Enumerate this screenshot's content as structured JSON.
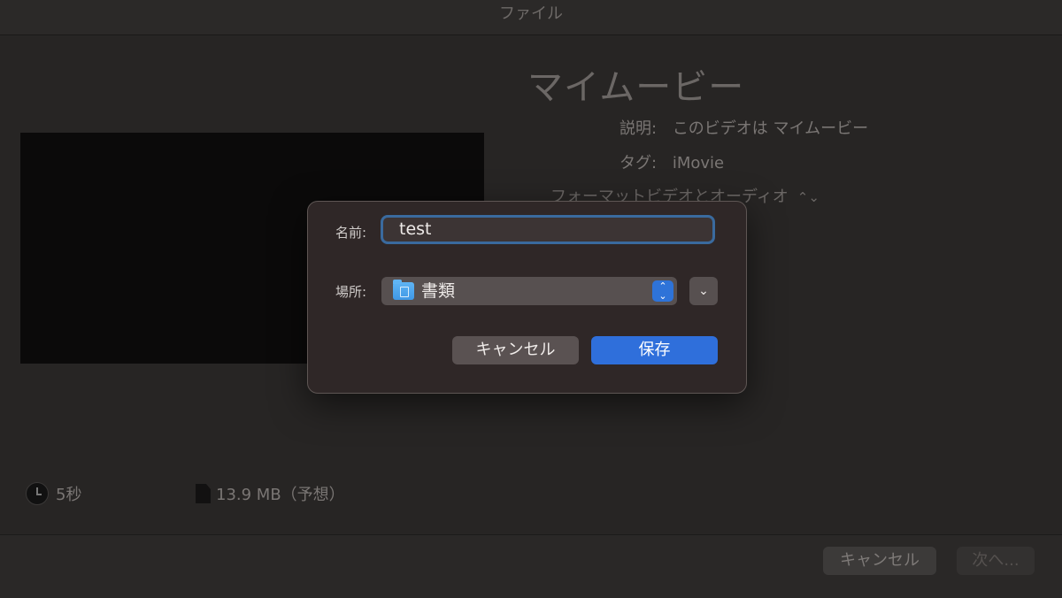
{
  "window": {
    "title": "ファイル"
  },
  "movie": {
    "title": "マイムービー",
    "description_label": "説明:",
    "description_value": "このビデオは マイムービー",
    "tags_label": "タグ:",
    "tags_value": "iMovie",
    "format_label": "フォーマット",
    "format_value": "ビデオとオーディオ",
    "format_icon": "chevron-updown-icon"
  },
  "info": {
    "duration": "5秒",
    "duration_icon": "clock-icon",
    "size": "13.9 MB（予想）",
    "size_icon": "document-icon"
  },
  "footer": {
    "cancel_label": "キャンセル",
    "next_label": "次へ..."
  },
  "save_dialog": {
    "name_label": "名前:",
    "name_value": "test",
    "location_label": "場所:",
    "location_value": "書類",
    "location_icon": "folder-icon",
    "cancel_label": "キャンセル",
    "save_label": "保存",
    "accent_color": "#2f6fdb"
  }
}
